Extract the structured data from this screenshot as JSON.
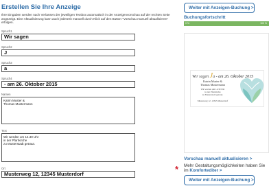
{
  "left": {
    "title": "Erstellen Sie Ihre Anzeige",
    "intro": "Ihre Eingaben werden nach Verlassen der jeweiligen Textbox automatisch in der Anzeigenvorschau auf der rechten Seite angezeigt. Eine Aktualisierung kann auch jederzeit manuell durch Klick auf den Button \"Vorschau manuell aktualisieren\" erfolgen.",
    "fields": {
      "spruch1": {
        "label": "Spruch1",
        "value": "Wir sagen"
      },
      "spruch2": {
        "label": "Spruch2",
        "value": "J"
      },
      "spruch3": {
        "label": "Spruch3",
        "value": "a"
      },
      "spruch4": {
        "label": "Spruch4",
        "value": "- am 26. Oktober 2015"
      },
      "namen": {
        "label": "Namen",
        "value": "Katrin Muster &\nThomas Mustermann"
      },
      "text": {
        "label": "Text",
        "value": "Wir werden um 14.30 Uhr\nin der Pfarrkirche\nzu Musterstadt getraut."
      },
      "ort": {
        "label": "Ort",
        "value": "Musterweg 12, 12345 Musterdorf"
      }
    }
  },
  "right": {
    "button_top": "Weiter mit Anzeigen-Buchung >",
    "progress_title": "Buchungsfortschritt",
    "progress_start": "0 %",
    "progress_end": "100 %",
    "progress_fraction": 1.0,
    "preview": {
      "headline_part1": "Wir sagen",
      "headline_j": "J",
      "headline_a": "a",
      "headline_date": "- am 26. Oktober 2015",
      "names": "Katrin Muster &\nThomas Mustermann",
      "text": "Wir werden um 14.30 Uhr\nin der Pfarrkirche\nzu Musterstadt getraut.",
      "address": "Musterweg 12, 12345 Musterdorf"
    },
    "preview_link": "Vorschau manuell aktualisieren >",
    "more_text": "Mehr Gestaltungsmöglichkeiten haben Sie im",
    "more_text_strong": "Komfortediter >",
    "asterisk": "*",
    "button_bottom": "Weiter mit Anzeigen-Buchung >"
  },
  "colors": {
    "accent": "#2f6da8",
    "progress": "#7bb661",
    "asterisk": "#d2202f",
    "highlight_j": "#d9a11f"
  }
}
